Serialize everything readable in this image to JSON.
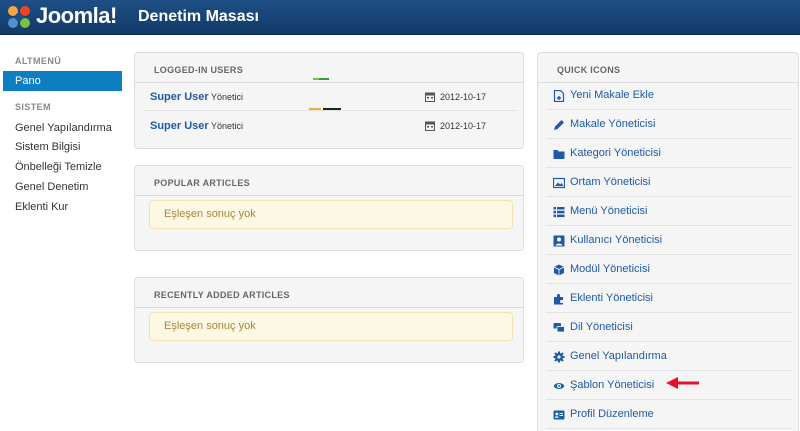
{
  "header": {
    "brand": "Joomla!",
    "title": "Denetim Masası"
  },
  "sidebar": {
    "menu_heading": "ALTMENÜ",
    "active_item": "Pano",
    "system_heading": "SISTEM",
    "items": [
      "Genel Yapılandırma",
      "Sistem Bilgisi",
      "Önbelleği Temizle",
      "Genel Denetim",
      "Eklenti Kur"
    ]
  },
  "logged_in": {
    "title": "LOGGED-IN USERS",
    "users": [
      {
        "name": "Super User",
        "role": "Yönetici",
        "date": "2012-10-17"
      },
      {
        "name": "Super User",
        "role": "Yönetici",
        "date": "2012-10-17"
      }
    ]
  },
  "popular": {
    "title": "POPULAR ARTICLES",
    "empty": "Eşleşen sonuç yok"
  },
  "recent": {
    "title": "RECENTLY ADDED ARTICLES",
    "empty": "Eşleşen sonuç yok"
  },
  "quick_icons": {
    "title": "QUICK ICONS",
    "items": [
      {
        "label": "Yeni Makale Ekle",
        "icon": "new-article-icon"
      },
      {
        "label": "Makale Yöneticisi",
        "icon": "pencil-icon"
      },
      {
        "label": "Kategori Yöneticisi",
        "icon": "folder-icon"
      },
      {
        "label": "Ortam Yöneticisi",
        "icon": "image-icon"
      },
      {
        "label": "Menü Yöneticisi",
        "icon": "list-icon"
      },
      {
        "label": "Kullanıcı Yöneticisi",
        "icon": "user-icon"
      },
      {
        "label": "Modül Yöneticisi",
        "icon": "cube-icon"
      },
      {
        "label": "Eklenti Yöneticisi",
        "icon": "puzzle-icon"
      },
      {
        "label": "Dil Yöneticisi",
        "icon": "comments-icon"
      },
      {
        "label": "Genel Yapılandırma",
        "icon": "gear-icon"
      },
      {
        "label": "Şablon Yöneticisi",
        "icon": "eye-icon"
      },
      {
        "label": "Profil Düzenleme",
        "icon": "profile-card-icon"
      }
    ]
  },
  "colors": {
    "header": "#1a4778",
    "link": "#1e5aa5",
    "active": "#0e7ec3",
    "alert_bg": "#fcf8e3",
    "arrow": "#e8102a"
  }
}
